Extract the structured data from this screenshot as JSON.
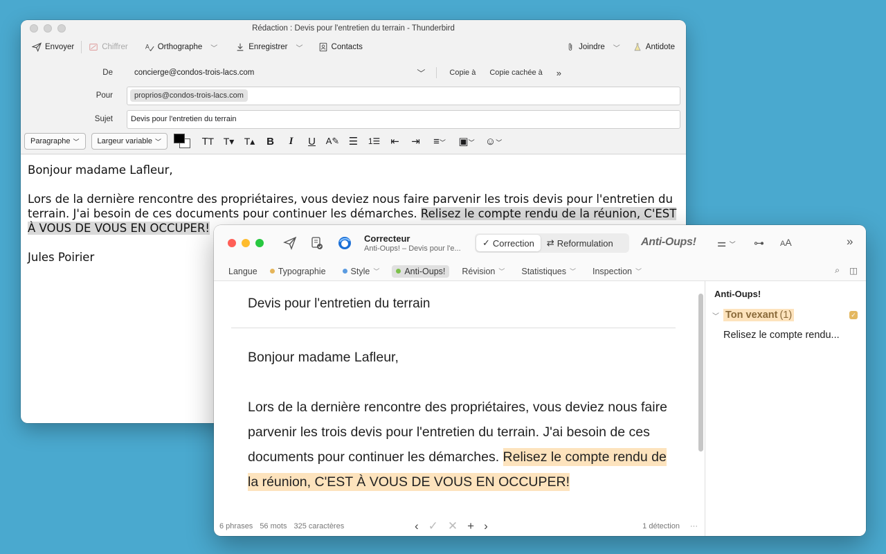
{
  "thunderbird": {
    "title": "Rédaction : Devis pour l'entretien du terrain - Thunderbird",
    "toolbar": {
      "send": "Envoyer",
      "encrypt": "Chiffrer",
      "spelling": "Orthographe",
      "save": "Enregistrer",
      "contacts": "Contacts",
      "attach": "Joindre",
      "antidote": "Antidote"
    },
    "headers": {
      "from_label": "De",
      "from_value": "concierge@condos-trois-lacs.com",
      "cc": "Copie à",
      "bcc": "Copie cachée à",
      "to_label": "Pour",
      "to_value": "proprios@condos-trois-lacs.com",
      "subject_label": "Sujet",
      "subject_value": "Devis pour l'entretien du terrain"
    },
    "format": {
      "paragraph": "Paragraphe",
      "font": "Largeur variable"
    },
    "body": {
      "greeting": "Bonjour madame Lafleur,",
      "para_plain": "Lors de la dernière rencontre des propriétaires, vous deviez nous faire parvenir les trois devis pour l'entretien du terrain. J'ai besoin de ces documents pour continuer les démarches. ",
      "para_highlight": "Relisez le compte rendu de la réunion, C'EST À VOUS DE VOUS EN OCCUPER!",
      "signature": "Jules Poirier"
    }
  },
  "antidote": {
    "app_title": "Correcteur",
    "app_subtitle": "Anti-Oups! – Devis pour l'e...",
    "mode_correction": "Correction",
    "mode_reformulation": "Reformulation",
    "logo": "Anti-Oups!",
    "tabs": {
      "langue": "Langue",
      "typographie": "Typographie",
      "style": "Style",
      "antioups": "Anti-Oups!",
      "revision": "Révision",
      "statistiques": "Statistiques",
      "inspection": "Inspection"
    },
    "doc": {
      "subject": "Devis pour l'entretien du terrain",
      "greeting": "Bonjour madame Lafleur,",
      "para_plain": "Lors de la dernière rencontre des propriétaires, vous deviez nous faire parvenir les trois devis pour l'entretien du terrain. J'ai besoin de ces documents pour continuer les démarches. ",
      "para_highlight": "Relisez le compte rendu de la réunion, C'EST À VOUS DE VOUS EN OCCUPER!"
    },
    "status": {
      "sentences": "6 phrases",
      "words": "56 mots",
      "chars": "325 caractères",
      "detections": "1 détection"
    },
    "side": {
      "title": "Anti-Oups!",
      "group_name": "Ton vexant",
      "group_count": "(1)",
      "item": "Relisez le compte rendu..."
    },
    "colors": {
      "typographie": "#e5b55a",
      "style": "#5b9be0",
      "antioups": "#7cc04a",
      "highlight": "#fde3bd"
    }
  }
}
